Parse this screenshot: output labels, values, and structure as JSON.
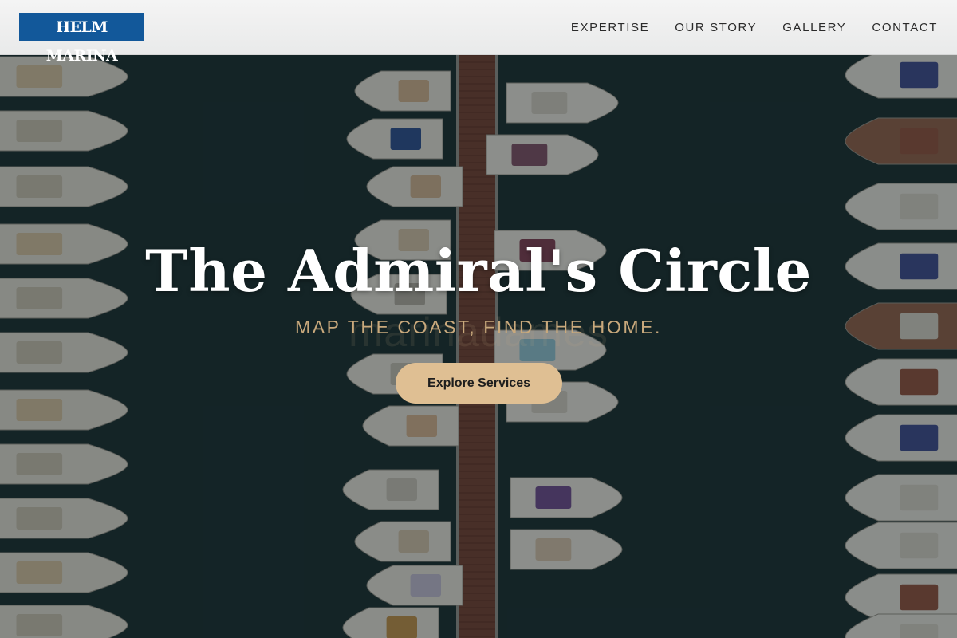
{
  "brand": {
    "logo_text": "HELM MARINA"
  },
  "nav": {
    "items": [
      "EXPERTISE",
      "OUR STORY",
      "GALLERY",
      "CONTACT"
    ]
  },
  "hero": {
    "title": "The Admiral's Circle",
    "subtitle": "MAP THE COAST, FIND THE HOME.",
    "background_watermark": "marinadames",
    "cta_label": "Explore Services"
  },
  "colors": {
    "logo_bg": "#12589a",
    "accent_gold": "#dfbf93",
    "subtitle_gold": "#c9a97c",
    "water": "#152427",
    "dock": "#7a4a3c"
  },
  "background_image": "aerial-marina-boats-photo"
}
